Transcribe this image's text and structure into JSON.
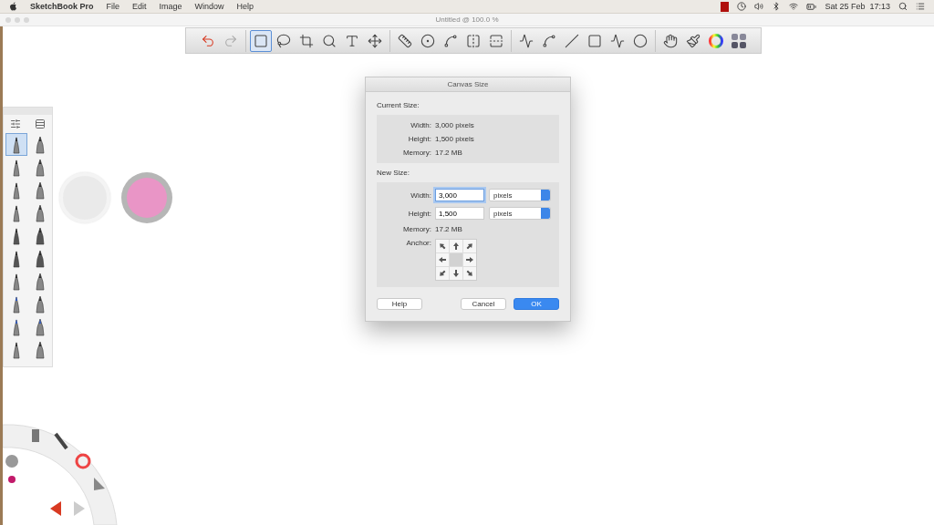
{
  "menu_bar": {
    "app": "SketchBook Pro",
    "menus": [
      "File",
      "Edit",
      "Image",
      "Window",
      "Help"
    ],
    "clock": "Sat 25 Feb  17:13"
  },
  "window": {
    "title": "Untitled @ 100.0 %"
  },
  "toolbar": {
    "groups": [
      {
        "tools": [
          {
            "selected": false
          },
          {
            "selected": false
          }
        ]
      },
      {
        "tools": [
          {
            "selected": true
          },
          {
            "selected": false
          },
          {
            "selected": false
          },
          {
            "selected": false
          },
          {
            "selected": false
          },
          {
            "selected": false
          }
        ]
      },
      {
        "tools": [
          {
            "selected": false
          },
          {
            "selected": false
          },
          {
            "selected": false
          },
          {
            "selected": false
          },
          {
            "selected": false
          }
        ]
      },
      {
        "tools": [
          {
            "selected": false
          },
          {
            "selected": false
          },
          {
            "selected": false
          },
          {
            "selected": false
          },
          {
            "selected": false
          },
          {
            "selected": false
          }
        ]
      },
      {
        "tools": [
          {
            "selected": false
          },
          {
            "selected": false
          },
          {
            "selected": false
          },
          {
            "selected": false
          }
        ]
      }
    ]
  },
  "brush_palette": {
    "brushes": [
      {
        "selected": true
      },
      {
        "selected": false
      },
      {
        "selected": false
      },
      {
        "selected": false
      },
      {
        "selected": false
      },
      {
        "selected": false
      },
      {
        "selected": false
      },
      {
        "selected": false
      },
      {
        "selected": false
      },
      {
        "selected": false
      },
      {
        "selected": false
      },
      {
        "selected": false
      },
      {
        "selected": false
      },
      {
        "selected": false
      },
      {
        "selected": false
      },
      {
        "selected": false
      },
      {
        "selected": false
      },
      {
        "selected": false
      },
      {
        "selected": false
      },
      {
        "selected": false
      }
    ]
  },
  "color_puck": {
    "color": "#e995c6"
  },
  "dialog": {
    "title": "Canvas Size",
    "current_size": {
      "label": "Current Size:",
      "rows": [
        {
          "label": "Width:",
          "value": "3,000 pixels"
        },
        {
          "label": "Height:",
          "value": "1,500 pixels"
        },
        {
          "label": "Memory:",
          "value": "17.2 MB"
        }
      ]
    },
    "new_size": {
      "label": "New Size:",
      "fields": [
        {
          "label": "Width:",
          "value": "3,000",
          "unit": "pixels",
          "focused": true
        },
        {
          "label": "Height:",
          "value": "1,500",
          "unit": "pixels",
          "focused": false
        }
      ],
      "memory": {
        "label": "Memory:",
        "value": "17.2 MB"
      },
      "anchor": {
        "label": "Anchor:",
        "cells": [
          {
            "selected": false
          },
          {
            "selected": false
          },
          {
            "selected": false
          },
          {
            "selected": false
          },
          {
            "selected": true
          },
          {
            "selected": false
          },
          {
            "selected": false
          },
          {
            "selected": false
          },
          {
            "selected": false
          }
        ]
      }
    },
    "buttons": [
      {
        "label": "Help",
        "kind": "plain"
      },
      {
        "label": "Cancel",
        "kind": "plain"
      },
      {
        "label": "OK",
        "kind": "default"
      }
    ]
  }
}
